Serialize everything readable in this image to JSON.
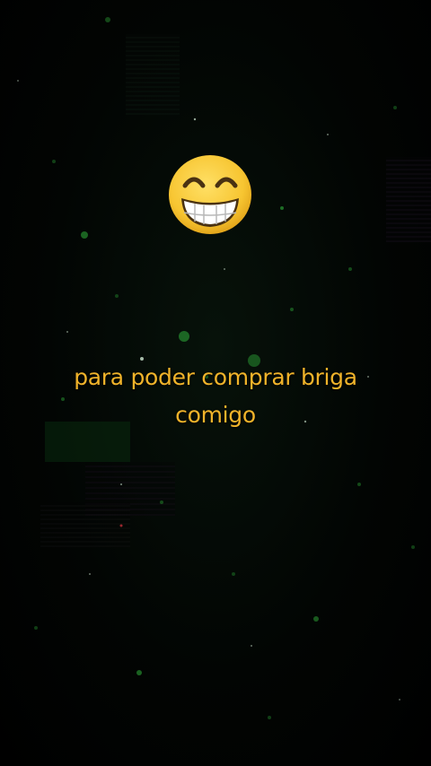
{
  "caption": {
    "line1": "para poder comprar briga",
    "line2": "comigo"
  },
  "emoji": {
    "icon": "grinning-face-with-smiling-eyes-icon"
  },
  "colors": {
    "background": "#000000",
    "caption_text": "#f0b32a",
    "particle_green": "#2fae3a",
    "emoji_face": "#f7c531"
  }
}
